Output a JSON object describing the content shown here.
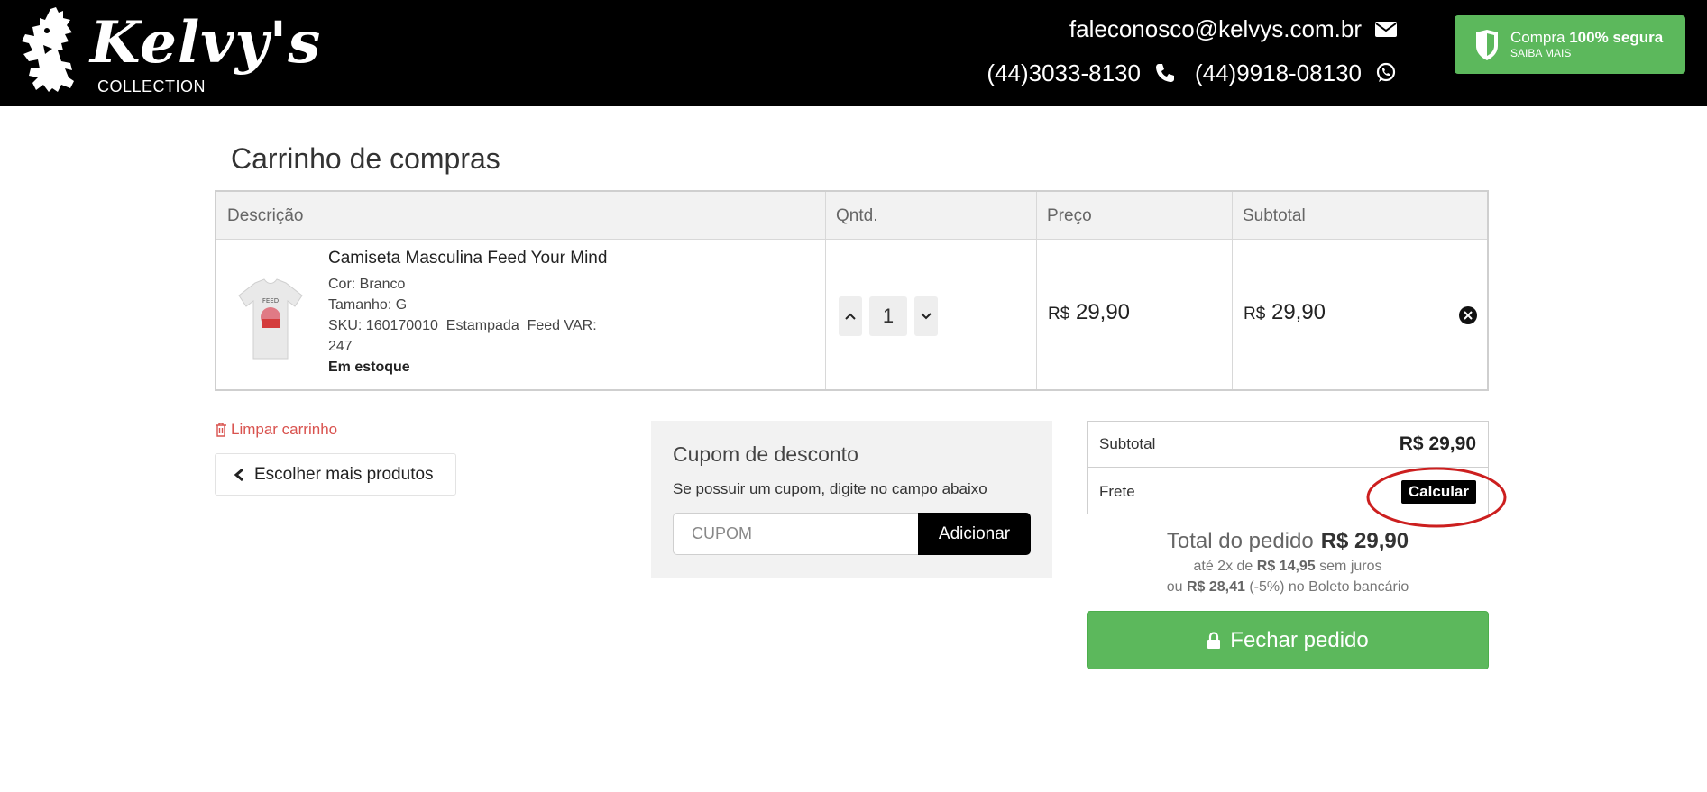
{
  "header": {
    "logo_text": "Kelvy's",
    "logo_subtext": "COLLECTION",
    "email": "faleconosco@kelvys.com.br",
    "phone": "(44)3033-8130",
    "whatsapp": "(44)9918-08130",
    "secure": {
      "title_prefix": "Compra",
      "title_bold": "100% segura",
      "subtitle": "SAIBA MAIS"
    }
  },
  "page_title": "Carrinho de compras",
  "cart": {
    "columns": [
      "Descrição",
      "Qntd.",
      "Preço",
      "Subtotal"
    ],
    "items": [
      {
        "name": "Camiseta Masculina Feed Your Mind",
        "color": "Cor: Branco",
        "size": "Tamanho: G",
        "sku_line1": "SKU: 160170010_Estampada_Feed VAR:",
        "sku_line2": "247",
        "stock": "Em estoque",
        "quantity": "1",
        "currency": "R$",
        "price": "29,90",
        "subtotal": "29,90"
      }
    ]
  },
  "actions": {
    "clear_cart": "Limpar carrinho",
    "more_products": "Escolher mais produtos"
  },
  "coupon": {
    "title": "Cupom de desconto",
    "description": "Se possuir um cupom, digite no campo abaixo",
    "placeholder": "CUPOM",
    "value": "",
    "button": "Adicionar"
  },
  "summary": {
    "subtotal_label": "Subtotal",
    "subtotal_value": "R$ 29,90",
    "shipping_label": "Frete",
    "shipping_button": "Calcular",
    "total_label": "Total do pedido",
    "total_value": "R$ 29,90",
    "installments_prefix": "até 2x de",
    "installments_value": "R$ 14,95",
    "installments_suffix": "sem juros",
    "boleto_prefix": "ou",
    "boleto_value": "R$ 28,41",
    "boleto_suffix": "(-5%) no Boleto bancário",
    "checkout_button": "Fechar pedido"
  },
  "colors": {
    "header_bg": "#000000",
    "accent_green": "#5cb85c",
    "danger_red": "#d9534f",
    "annotation_red": "#cc1f1f"
  }
}
